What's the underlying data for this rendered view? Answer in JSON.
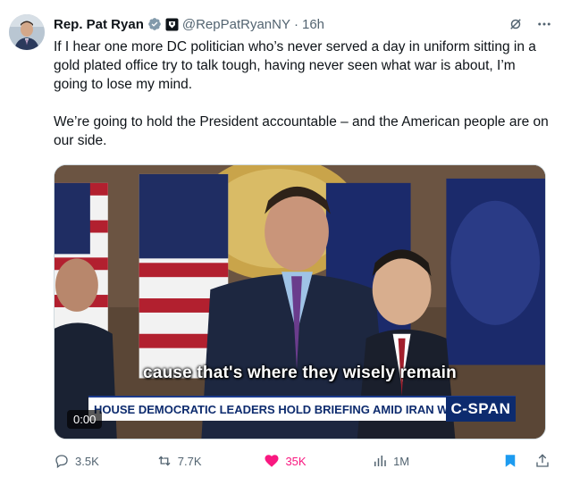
{
  "author": {
    "name": "Rep. Pat Ryan",
    "handle": "@RepPatRyanNY",
    "separator": "·",
    "time": "16h"
  },
  "tweet": {
    "paragraphs": [
      "If I hear one more DC politician who’s never served a day in uniform sitting in a gold plated office try to talk tough, having never seen what war is about, I’m going to lose my mind.",
      "We’re going to hold the President accountable – and the American people are on our side."
    ]
  },
  "video": {
    "caption": "cause that's where they wisely remain",
    "chyron": "HOUSE DEMOCRATIC LEADERS HOLD BRIEFING AMID IRAN WAR",
    "network_logo": "C-SPAN",
    "timestamp": "0:00"
  },
  "actions": {
    "replies": "3.5K",
    "reposts": "7.7K",
    "likes": "35K",
    "views": "1M"
  },
  "colors": {
    "text": "#0f1419",
    "secondary": "#536471",
    "like": "#f91880",
    "verified": "#829aab",
    "bookmark": "#1d9bf0",
    "cspan": "#0d2b6e"
  },
  "icons": {
    "verified": "verified-badge-icon",
    "affiliate": "government-affiliate-icon",
    "grok": "grok-icon",
    "more": "more-icon",
    "reply": "reply-icon",
    "repost": "repost-icon",
    "like": "heart-icon",
    "views": "views-icon",
    "bookmark": "bookmark-icon",
    "share": "share-icon"
  }
}
